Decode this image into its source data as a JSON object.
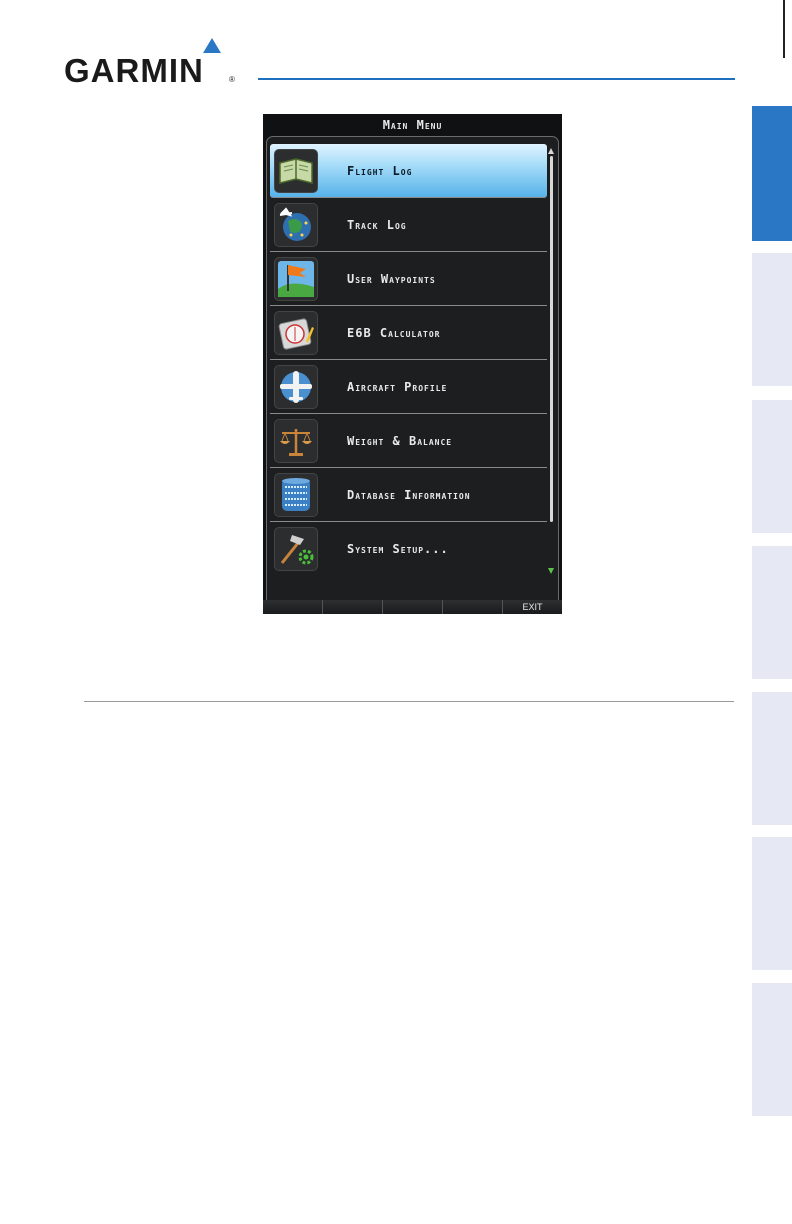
{
  "brand": {
    "logo_text": "GARMIN",
    "registered_mark": "®"
  },
  "screen": {
    "title": "Main Menu",
    "menu_items": [
      {
        "label": "Flight Log",
        "icon": "flight-log-book-icon",
        "selected": true
      },
      {
        "label": "Track Log",
        "icon": "track-log-globe-icon",
        "selected": false
      },
      {
        "label": "User Waypoints",
        "icon": "user-waypoints-flag-icon",
        "selected": false
      },
      {
        "label": "E6B Calculator",
        "icon": "e6b-calculator-icon",
        "selected": false
      },
      {
        "label": "Aircraft Profile",
        "icon": "aircraft-profile-plane-icon",
        "selected": false
      },
      {
        "label": "Weight & Balance",
        "icon": "weight-balance-scale-icon",
        "selected": false
      },
      {
        "label": "Database Information",
        "icon": "database-information-icon",
        "selected": false
      },
      {
        "label": "System Setup...",
        "icon": "system-setup-tools-icon",
        "selected": false
      }
    ],
    "softkeys": [
      "",
      "",
      "",
      "",
      "EXIT"
    ]
  },
  "colors": {
    "accent_blue": "#2a78c5",
    "selected_highlight": "#56b2ea",
    "scroll_arrow_green": "#5dc24a"
  }
}
